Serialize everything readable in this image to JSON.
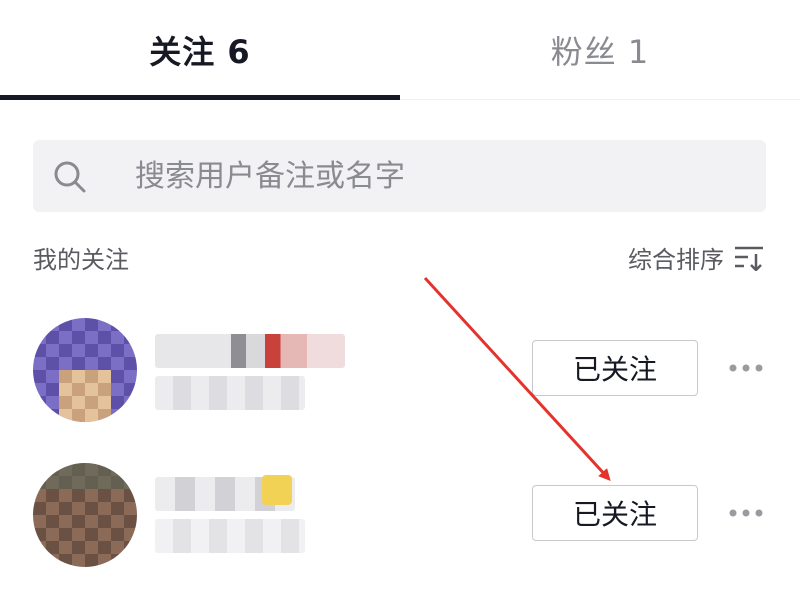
{
  "tabs": {
    "following_label": "关注 6",
    "fans_label": "粉丝 1"
  },
  "search": {
    "placeholder": "搜索用户备注或名字",
    "value": ""
  },
  "section": {
    "title": "我的关注",
    "sort_label": "综合排序"
  },
  "users": [
    {
      "follow_label": "已关注"
    },
    {
      "follow_label": "已关注"
    }
  ],
  "colors": {
    "text_primary": "#161823",
    "text_secondary": "#8a8b91",
    "annotation": "#e5322d"
  }
}
